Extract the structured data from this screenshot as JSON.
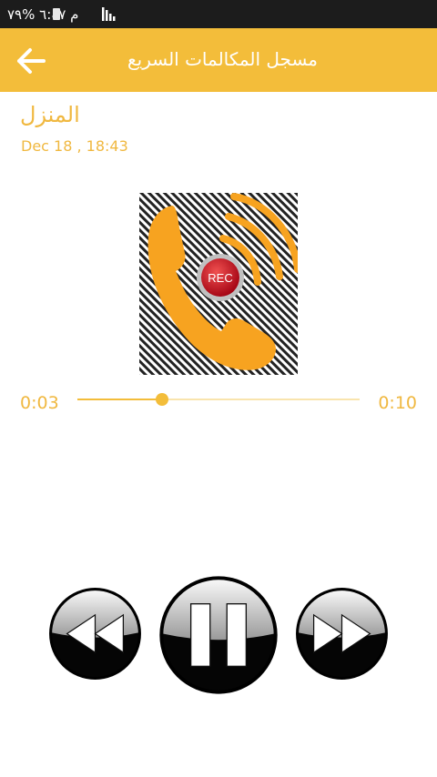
{
  "status_bar": {
    "text": "م ٦:٤٧ %٧٩"
  },
  "app_bar": {
    "title": "مسجل المكالمات السريع",
    "back_icon": "arrow-left-icon",
    "background_color": "#f3bd3a"
  },
  "recording": {
    "name": "المنزل",
    "date": "Dec 18 , 18:43",
    "artwork_icon": "phone-recording-icon",
    "artwork_badge": "REC"
  },
  "player": {
    "current_time": "0:03",
    "total_time": "0:10",
    "progress": 0.3,
    "controls": {
      "rewind_icon": "rewind-icon",
      "pause_icon": "pause-icon",
      "forward_icon": "fast-forward-icon"
    }
  },
  "colors": {
    "accent": "#f3bd3a",
    "text_accent": "#f0b840"
  }
}
